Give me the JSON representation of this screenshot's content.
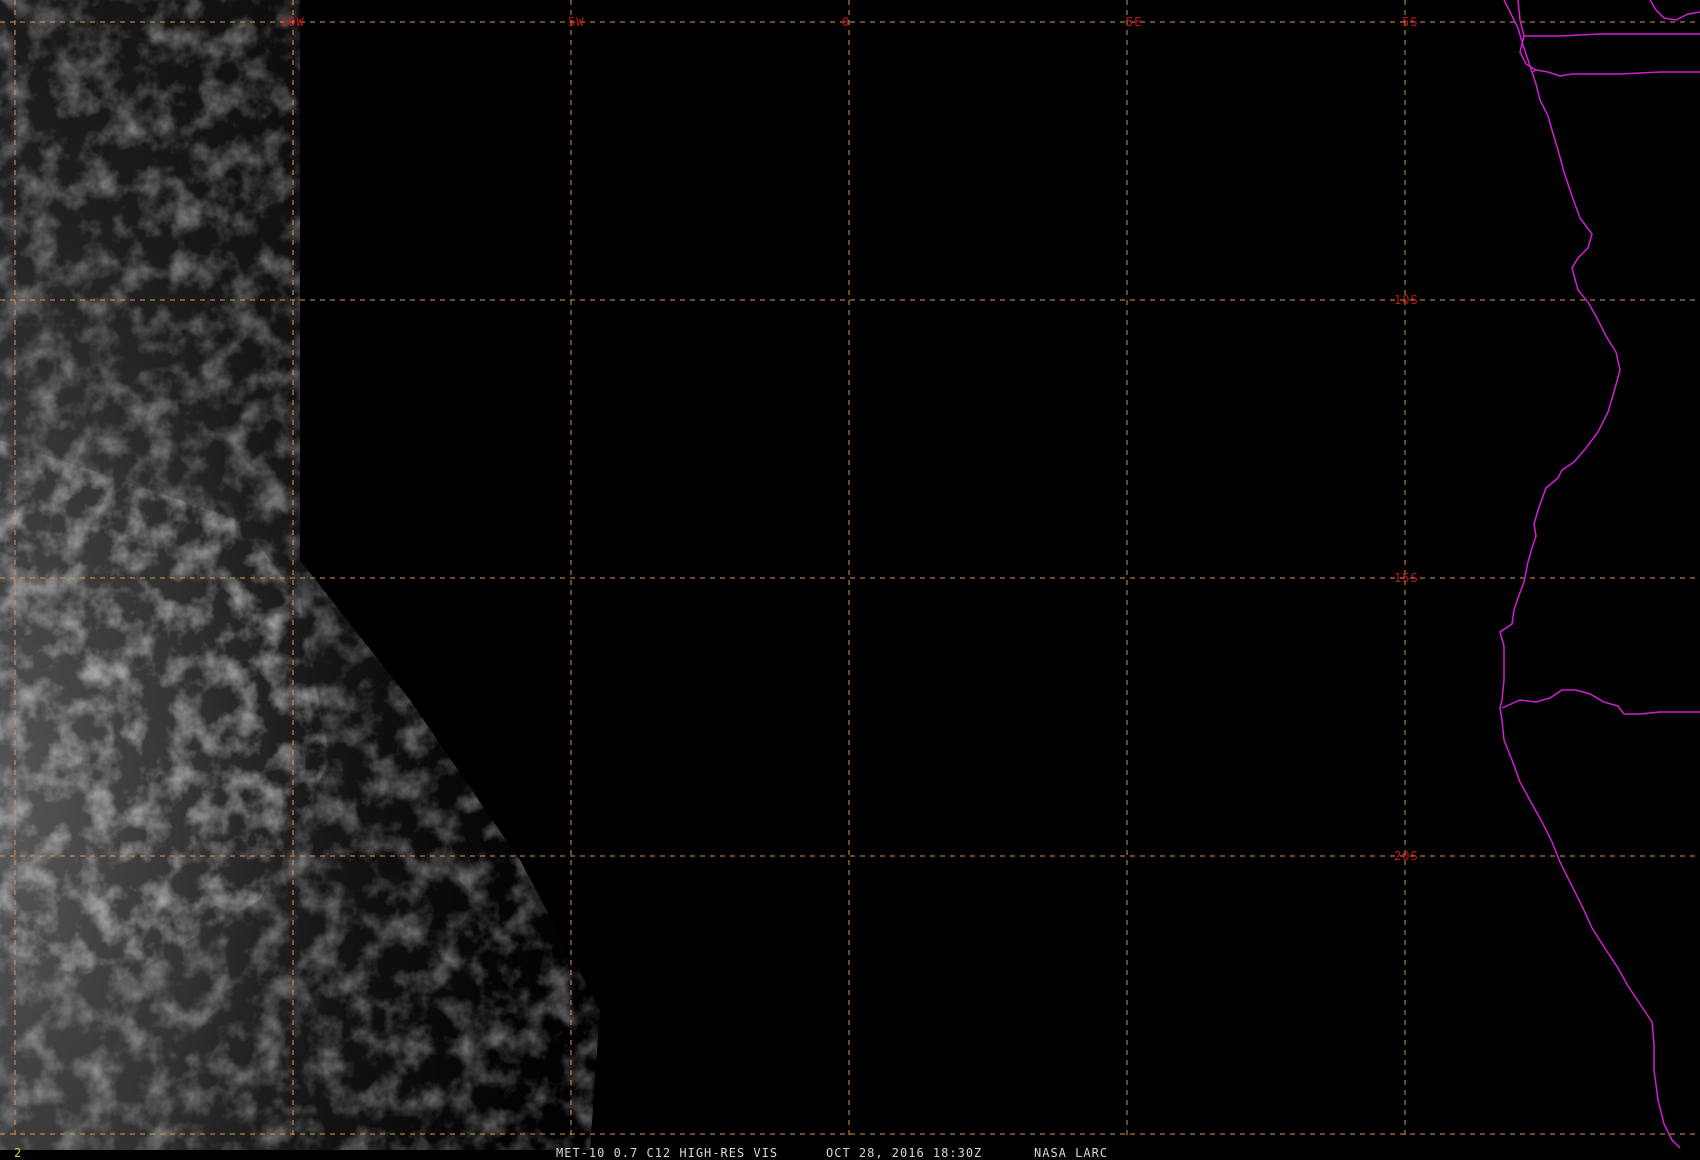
{
  "map": {
    "frame_number": "2",
    "caption": {
      "satellite_product": "MET-10 0.7 C12 HIGH-RES VIS",
      "date_time": "OCT 28, 2016 18:30Z",
      "source": "NASA LARC"
    },
    "longitude_labels": [
      "10W",
      "5W",
      "0",
      "5E"
    ],
    "latitude_labels": [
      "5S",
      "10S",
      "15S",
      "20S"
    ],
    "colors": {
      "background": "#000000",
      "grid_lines": "#d9965a",
      "grid_labels": "#c81414",
      "coastline": "#d21ed2",
      "clouds": "#8a8a8a",
      "frame_number": "#e8d23c",
      "caption": "#d8d8d8"
    },
    "layers": {
      "graticule": "dashed",
      "coastlines": "solid"
    }
  }
}
